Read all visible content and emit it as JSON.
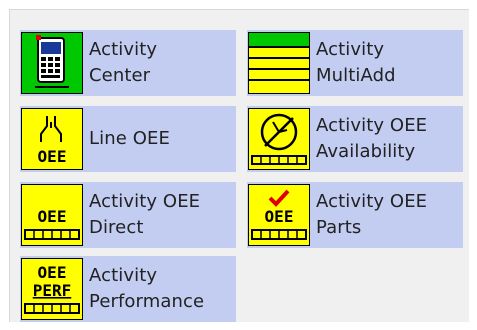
{
  "tiles": [
    {
      "label": "Activity\nCenter",
      "icon": "activity-center-icon"
    },
    {
      "label": "Activity\nMultiAdd",
      "icon": "activity-multiadd-icon"
    },
    {
      "label": "Line OEE",
      "icon": "line-oee-icon",
      "icon_text": "OEE"
    },
    {
      "label": "Activity OEE\nAvailability",
      "icon": "oee-availability-icon"
    },
    {
      "label": "Activity OEE\nDirect",
      "icon": "oee-direct-icon",
      "icon_text": "OEE"
    },
    {
      "label": "Activity OEE\nParts",
      "icon": "oee-parts-icon",
      "icon_text": "OEE"
    },
    {
      "label": "Activity\nPerformance",
      "icon": "oee-performance-icon",
      "icon_text": "OEE",
      "icon_text2": "PERF"
    }
  ],
  "colors": {
    "tile_bg": "#c3cdf2",
    "panel_bg": "#f0f0f0",
    "icon_yellow": "#ffff00",
    "icon_green": "#00c800",
    "check_red": "#e00000"
  }
}
